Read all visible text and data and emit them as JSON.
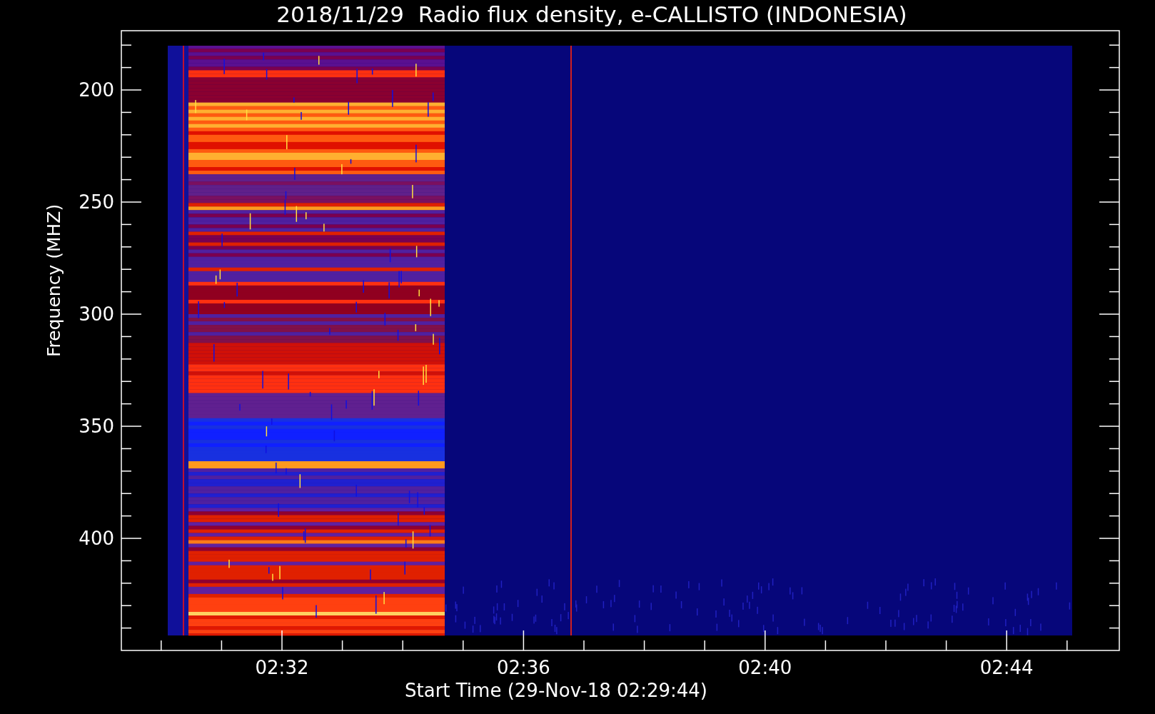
{
  "title": "2018/11/29  Radio flux density, e-CALLISTO (INDONESIA)",
  "y_axis": {
    "label": "Frequency (MHZ)",
    "ticks": [
      "200",
      "250",
      "300",
      "350",
      "400"
    ]
  },
  "x_axis": {
    "label": "Start Time (29-Nov-18 02:29:44)",
    "ticks": [
      "02:32",
      "02:36",
      "02:40",
      "02:44"
    ]
  }
}
